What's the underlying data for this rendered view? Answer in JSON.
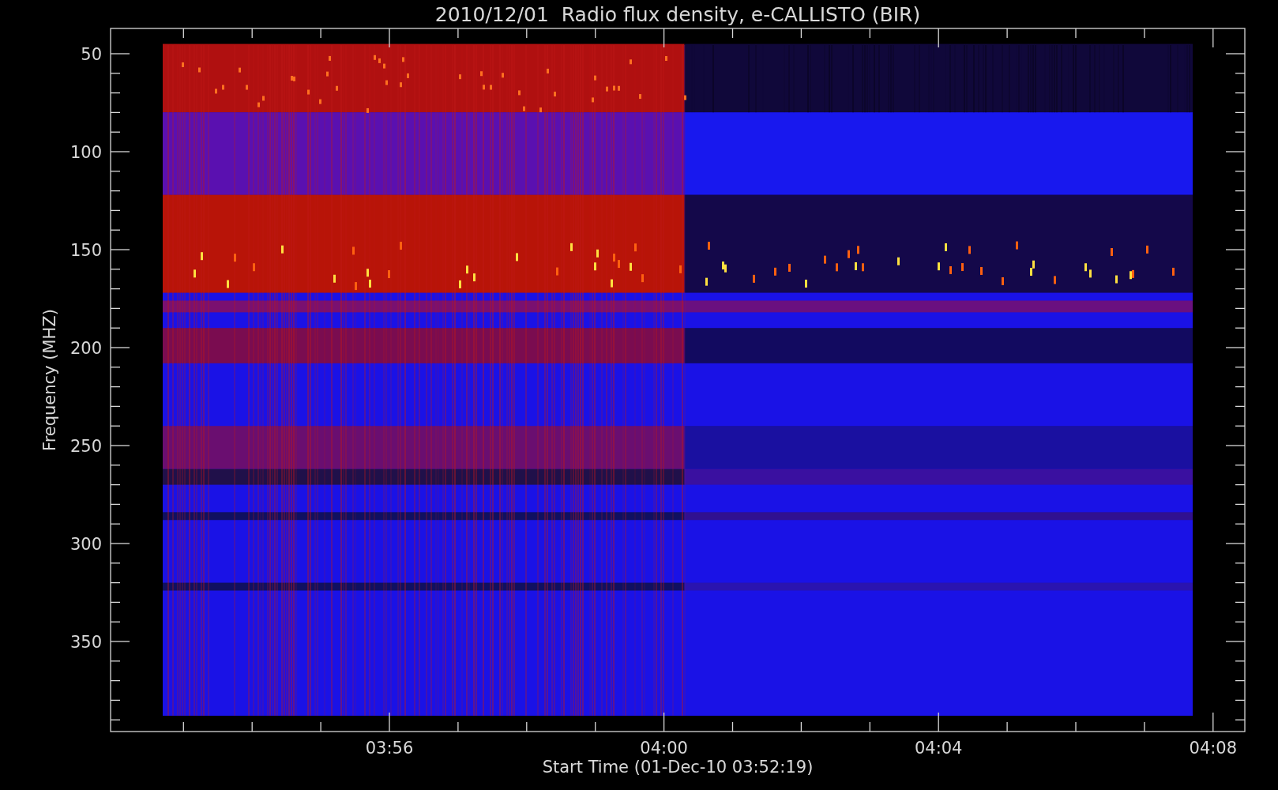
{
  "title": "2010/12/01  Radio flux density, e-CALLISTO (BIR)",
  "y_axis": {
    "label": "Frequency (MHZ)",
    "ticks": [
      "50",
      "100",
      "150",
      "200",
      "250",
      "300",
      "350"
    ]
  },
  "x_axis": {
    "label": "Start Time (01-Dec-10 03:52:19)",
    "ticks": [
      "03:56",
      "04:00",
      "04:04",
      "04:08"
    ]
  }
}
